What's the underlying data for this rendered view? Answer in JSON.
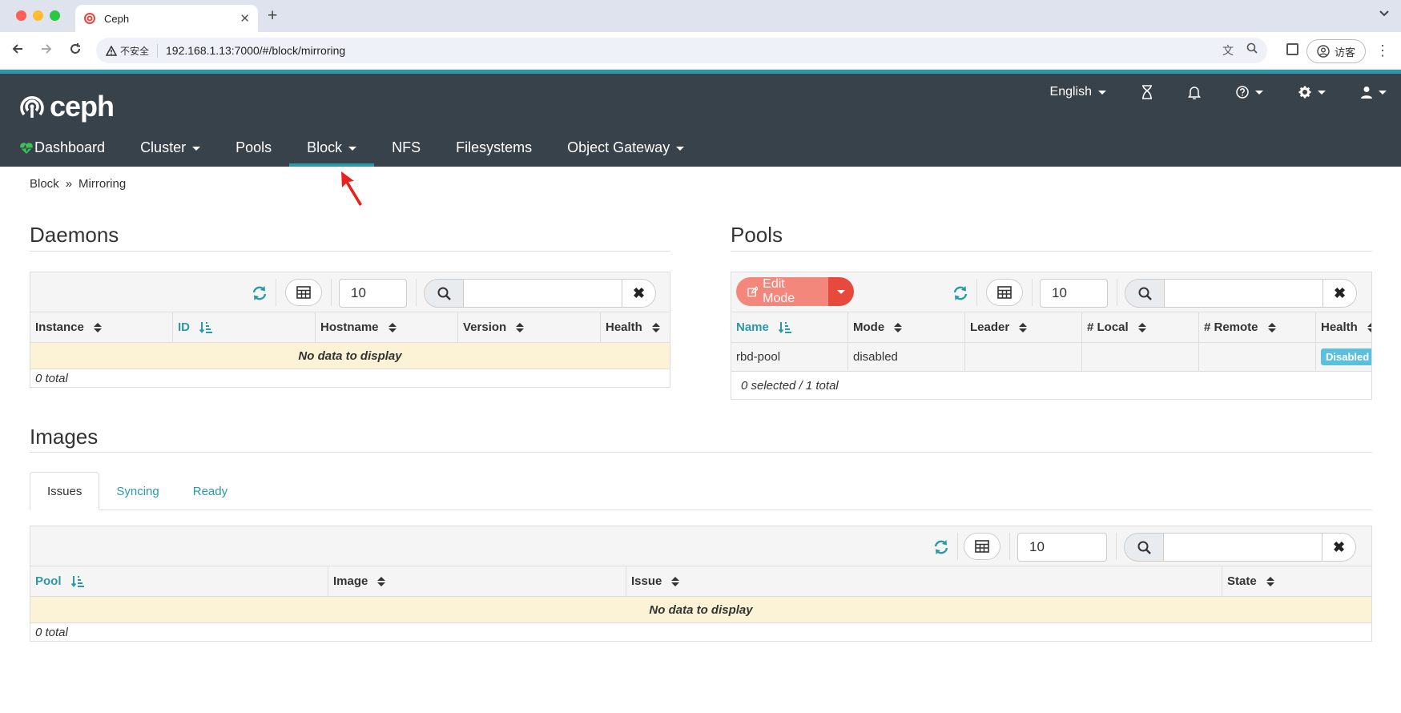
{
  "browser": {
    "tab_title": "Ceph",
    "insecure_label": "不安全",
    "url": "192.168.1.13:7000/#/block/mirroring",
    "profile_label": "访客"
  },
  "header": {
    "logo_text": "ceph",
    "language": "English",
    "nav": [
      {
        "label": "Dashboard"
      },
      {
        "label": "Cluster"
      },
      {
        "label": "Pools"
      },
      {
        "label": "Block"
      },
      {
        "label": "NFS"
      },
      {
        "label": "Filesystems"
      },
      {
        "label": "Object Gateway"
      }
    ]
  },
  "breadcrumb": {
    "parent": "Block",
    "current": "Mirroring"
  },
  "daemons": {
    "title": "Daemons",
    "limit": "10",
    "columns": [
      "Instance",
      "ID",
      "Hostname",
      "Version",
      "Health"
    ],
    "empty_text": "No data to display",
    "footer": "0 total"
  },
  "pools": {
    "title": "Pools",
    "edit_mode_label": "Edit Mode",
    "limit": "10",
    "columns": [
      "Name",
      "Mode",
      "Leader",
      "# Local",
      "# Remote",
      "Health"
    ],
    "rows": [
      {
        "name": "rbd-pool",
        "mode": "disabled",
        "leader": "",
        "local": "",
        "remote": "",
        "health": "Disabled"
      }
    ],
    "footer": "0 selected / 1 total"
  },
  "images": {
    "title": "Images",
    "tabs": [
      "Issues",
      "Syncing",
      "Ready"
    ],
    "limit": "10",
    "columns": [
      "Pool",
      "Image",
      "Issue",
      "State"
    ],
    "empty_text": "No data to display",
    "footer": "0 total"
  },
  "colors": {
    "accent": "#2b99a8",
    "header_bg": "#37424a",
    "edit_mode": "#f4877c",
    "badge": "#5bc0de",
    "annotation_arrow": "#e8211a"
  }
}
